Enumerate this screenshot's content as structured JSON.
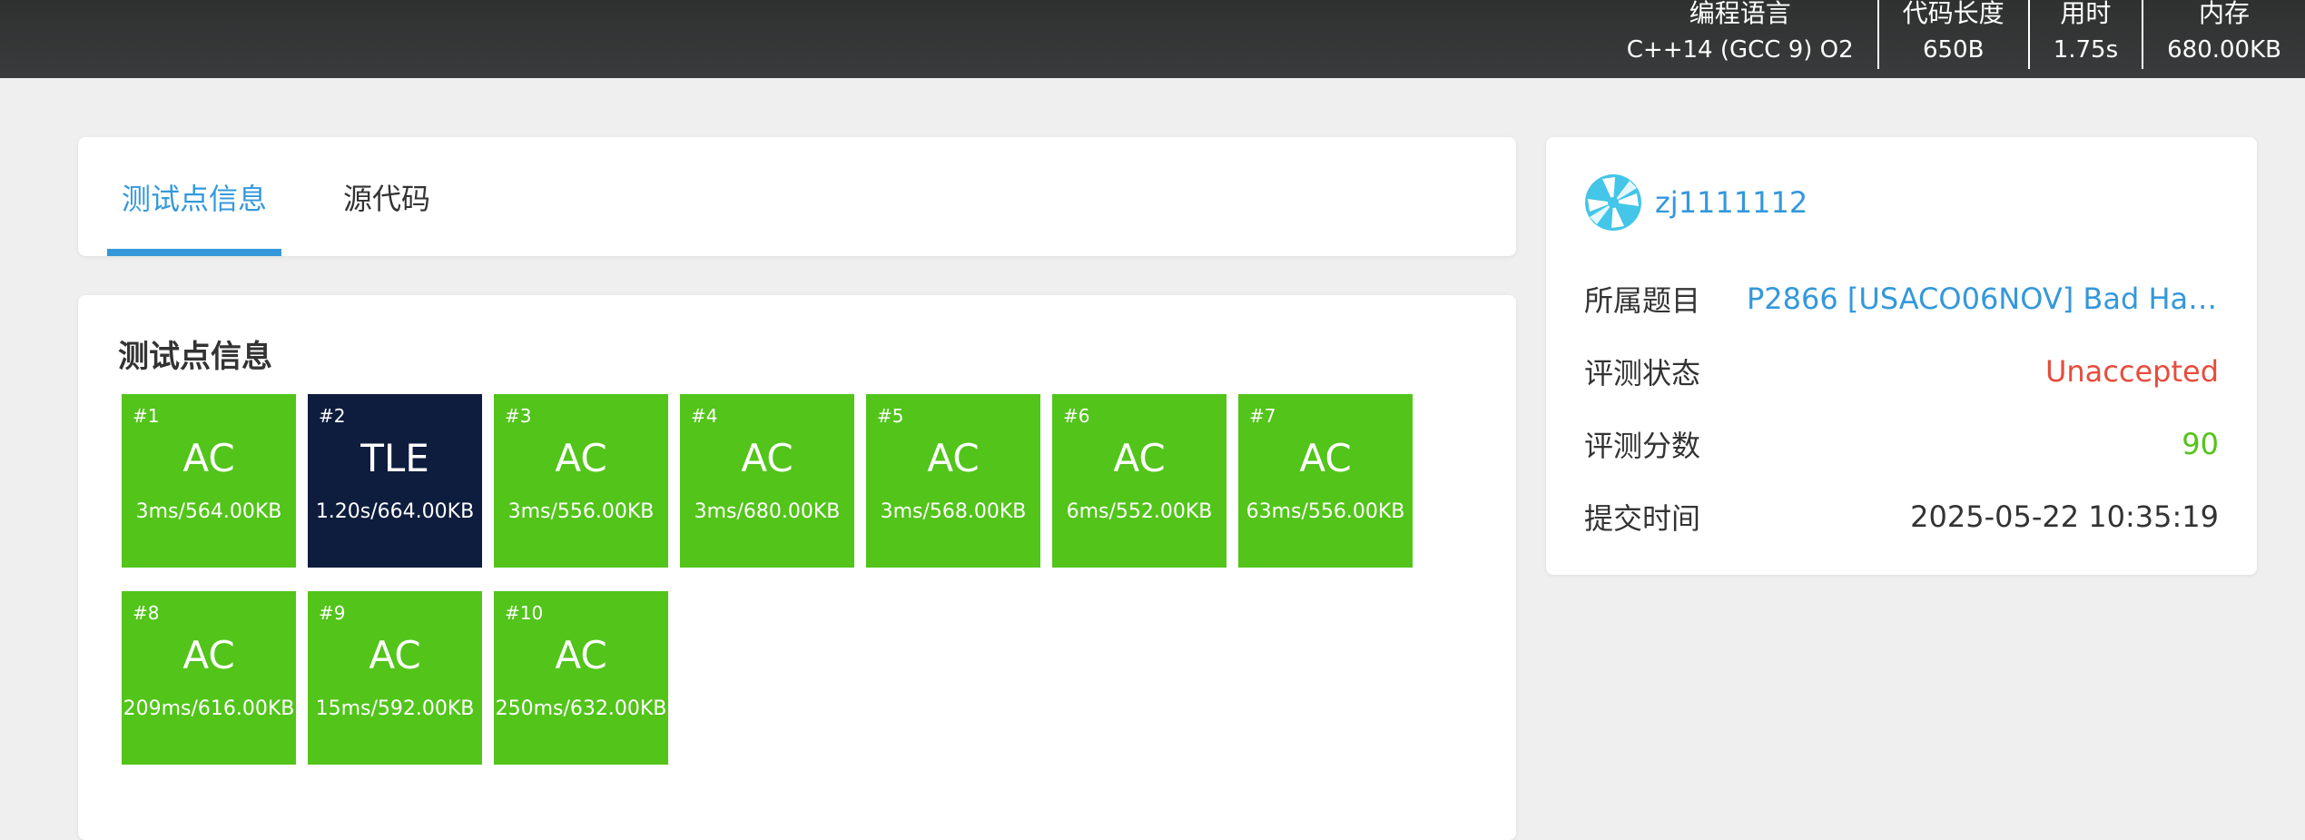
{
  "header": {
    "stats": [
      {
        "label": "编程语言",
        "value": "C++14 (GCC 9) O2"
      },
      {
        "label": "代码长度",
        "value": "650B"
      },
      {
        "label": "用时",
        "value": "1.75s"
      },
      {
        "label": "内存",
        "value": "680.00KB"
      }
    ]
  },
  "tabs": [
    {
      "label": "测试点信息",
      "active": true
    },
    {
      "label": "源代码",
      "active": false
    }
  ],
  "tests": {
    "title": "测试点信息",
    "cases": [
      {
        "num": "#1",
        "status": "AC",
        "detail": "3ms/564.00KB"
      },
      {
        "num": "#2",
        "status": "TLE",
        "detail": "1.20s/664.00KB"
      },
      {
        "num": "#3",
        "status": "AC",
        "detail": "3ms/556.00KB"
      },
      {
        "num": "#4",
        "status": "AC",
        "detail": "3ms/680.00KB"
      },
      {
        "num": "#5",
        "status": "AC",
        "detail": "3ms/568.00KB"
      },
      {
        "num": "#6",
        "status": "AC",
        "detail": "6ms/552.00KB"
      },
      {
        "num": "#7",
        "status": "AC",
        "detail": "63ms/556.00KB"
      },
      {
        "num": "#8",
        "status": "AC",
        "detail": "209ms/616.00KB"
      },
      {
        "num": "#9",
        "status": "AC",
        "detail": "15ms/592.00KB"
      },
      {
        "num": "#10",
        "status": "AC",
        "detail": "250ms/632.00KB"
      }
    ]
  },
  "info": {
    "avatar_icon": "avatar-icon",
    "username": "zj1111112",
    "problem_label": "所属题目",
    "problem_value": "P2866 [USACO06NOV] Bad Hai...",
    "status_label": "评测状态",
    "status_value": "Unaccepted",
    "score_label": "评测分数",
    "score_value": "90",
    "time_label": "提交时间",
    "time_value": "2025-05-22 10:35:19"
  },
  "colors": {
    "accent": "#3498db",
    "ac": "#52c41a",
    "tle": "#0e1d3e",
    "error": "#e74c3c"
  }
}
